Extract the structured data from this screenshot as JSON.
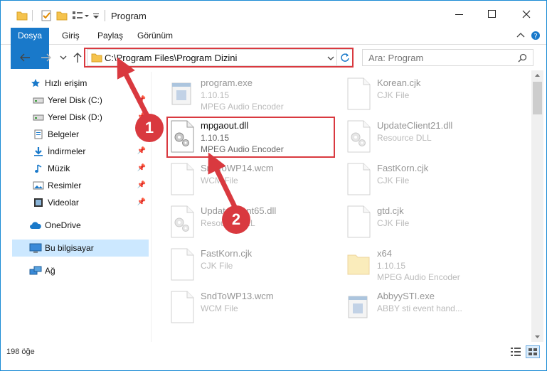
{
  "window": {
    "title": "Program"
  },
  "tabs": [
    {
      "label": "Dosya"
    },
    {
      "label": "Giriş"
    },
    {
      "label": "Paylaş"
    },
    {
      "label": "Görünüm"
    }
  ],
  "address": {
    "path": "C:\\Program Files\\Program Dizini"
  },
  "search": {
    "placeholder": "Ara: Program"
  },
  "sidebar": {
    "items": [
      {
        "label": "Hızlı erişim",
        "icon": "star-icon",
        "pinned": false
      },
      {
        "label": "Yerel Disk (C:)",
        "icon": "drive-icon",
        "pinned": true
      },
      {
        "label": "Yerel Disk (D:)",
        "icon": "drive-icon",
        "pinned": true
      },
      {
        "label": "Belgeler",
        "icon": "document-icon",
        "pinned": true
      },
      {
        "label": "İndirmeler",
        "icon": "download-icon",
        "pinned": true
      },
      {
        "label": "Müzik",
        "icon": "music-icon",
        "pinned": true
      },
      {
        "label": "Resimler",
        "icon": "picture-icon",
        "pinned": true
      },
      {
        "label": "Videolar",
        "icon": "video-icon",
        "pinned": true
      },
      {
        "label": "OneDrive",
        "icon": "cloud-icon",
        "pinned": false
      },
      {
        "label": "Bu bilgisayar",
        "icon": "computer-icon",
        "pinned": false,
        "selected": true
      },
      {
        "label": "Ağ",
        "icon": "network-icon",
        "pinned": false
      }
    ]
  },
  "files": {
    "left": [
      {
        "name": "program.exe",
        "line1": "1.10.15",
        "line2": "MPEG Audio Encoder",
        "faded": true
      },
      {
        "name": "mpgaout.dll",
        "line1": "1.10.15",
        "line2": "MPEG Audio Encoder",
        "faded": false
      },
      {
        "name": "SndToWP14.wcm",
        "line1": "WCM File",
        "line2": "",
        "faded": true
      },
      {
        "name": "UpdateClient65.dll",
        "line1": "Resource DLL",
        "line2": "",
        "faded": true
      },
      {
        "name": "FastKorn.cjk",
        "line1": "CJK File",
        "line2": "",
        "faded": true
      },
      {
        "name": "SndToWP13.wcm",
        "line1": "WCM File",
        "line2": "",
        "faded": true
      }
    ],
    "right": [
      {
        "name": "Korean.cjk",
        "line1": "CJK File",
        "line2": "",
        "faded": true
      },
      {
        "name": "UpdateClient21.dll",
        "line1": "Resource DLL",
        "line2": "",
        "faded": true
      },
      {
        "name": "FastKorn.cjk",
        "line1": "CJK File",
        "line2": "",
        "faded": true
      },
      {
        "name": "gtd.cjk",
        "line1": "CJK File",
        "line2": "",
        "faded": true
      },
      {
        "name": "x64",
        "line1": "1.10.15",
        "line2": "MPEG Audio Encoder",
        "faded": true
      },
      {
        "name": "AbbyySTI.exe",
        "line1": "ABBY sti event hand...",
        "line2": "",
        "faded": true
      }
    ]
  },
  "status": {
    "count": "198 öğe"
  },
  "callouts": {
    "one": "1",
    "two": "2"
  },
  "colors": {
    "accent": "#1979ca",
    "highlight": "#d9393f",
    "selection": "#cce8ff"
  }
}
